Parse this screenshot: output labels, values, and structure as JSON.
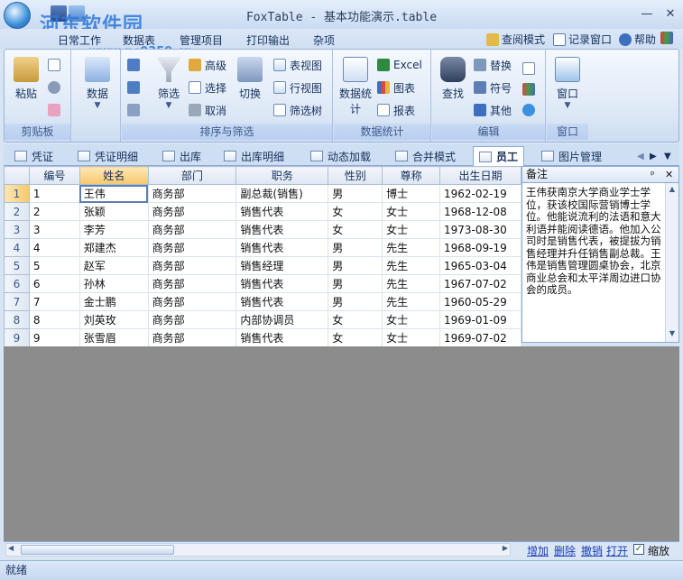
{
  "window": {
    "title": "FoxTable - 基本功能演示.table",
    "watermark": "河东软件园",
    "watermark_url": "www.pc0359.cn"
  },
  "menu": {
    "items": [
      "日常工作",
      "数据表",
      "管理项目",
      "打印输出",
      "杂项"
    ],
    "right": [
      "查阅模式",
      "记录窗口",
      "帮助"
    ]
  },
  "ribbon": {
    "clipboard": {
      "paste": "粘贴",
      "label": "剪贴板"
    },
    "data": {
      "label": "数据"
    },
    "sort": {
      "filter": "筛选",
      "advanced": "高级",
      "select": "选择",
      "cancel": "取消",
      "switch": "切换",
      "table_view": "表视图",
      "row_view": "行视图",
      "filter_tree": "筛选树",
      "label": "排序与筛选"
    },
    "stats": {
      "data_stats": "数据统计",
      "excel": "Excel",
      "chart": "图表",
      "report": "报表",
      "label": "数据统计"
    },
    "edit": {
      "find": "查找",
      "replace": "替换",
      "symbol": "符号",
      "other": "其他",
      "label": "编辑"
    },
    "window": {
      "window": "窗口",
      "label": "窗口"
    }
  },
  "tabs": [
    "凭证",
    "凭证明细",
    "出库",
    "出库明细",
    "动态加载",
    "合并模式",
    "员工",
    "图片管理"
  ],
  "active_tab": "员工",
  "grid": {
    "columns": [
      "编号",
      "姓名",
      "部门",
      "职务",
      "性别",
      "尊称",
      "出生日期"
    ],
    "rows": [
      [
        "1",
        "1",
        "王伟",
        "商务部",
        "副总裁(销售)",
        "男",
        "博士",
        "1962-02-19"
      ],
      [
        "2",
        "2",
        "张颖",
        "商务部",
        "销售代表",
        "女",
        "女士",
        "1968-12-08"
      ],
      [
        "3",
        "3",
        "李芳",
        "商务部",
        "销售代表",
        "女",
        "女士",
        "1973-08-30"
      ],
      [
        "4",
        "4",
        "郑建杰",
        "商务部",
        "销售代表",
        "男",
        "先生",
        "1968-09-19"
      ],
      [
        "5",
        "5",
        "赵军",
        "商务部",
        "销售经理",
        "男",
        "先生",
        "1965-03-04"
      ],
      [
        "6",
        "6",
        "孙林",
        "商务部",
        "销售代表",
        "男",
        "先生",
        "1967-07-02"
      ],
      [
        "7",
        "7",
        "金士鹏",
        "商务部",
        "销售代表",
        "男",
        "先生",
        "1960-05-29"
      ],
      [
        "8",
        "8",
        "刘英玫",
        "商务部",
        "内部协调员",
        "女",
        "女士",
        "1969-01-09"
      ],
      [
        "9",
        "9",
        "张雪眉",
        "商务部",
        "销售代表",
        "女",
        "女士",
        "1969-07-02"
      ]
    ]
  },
  "notes": {
    "title": "备注",
    "text": "王伟获南京大学商业学士学位，获该校国际营销博士学位。他能说流利的法语和意大利语并能阅读德语。他加入公司时是销售代表，被提拔为销售经理并升任销售副总裁。王伟是销售管理圆桌协会，北京商业总会和太平洋周边进口协会的成员。"
  },
  "bottom": {
    "links": [
      "增加",
      "删除",
      "撤销",
      "打开"
    ],
    "zoom_label": "缩放"
  },
  "status": "就绪"
}
